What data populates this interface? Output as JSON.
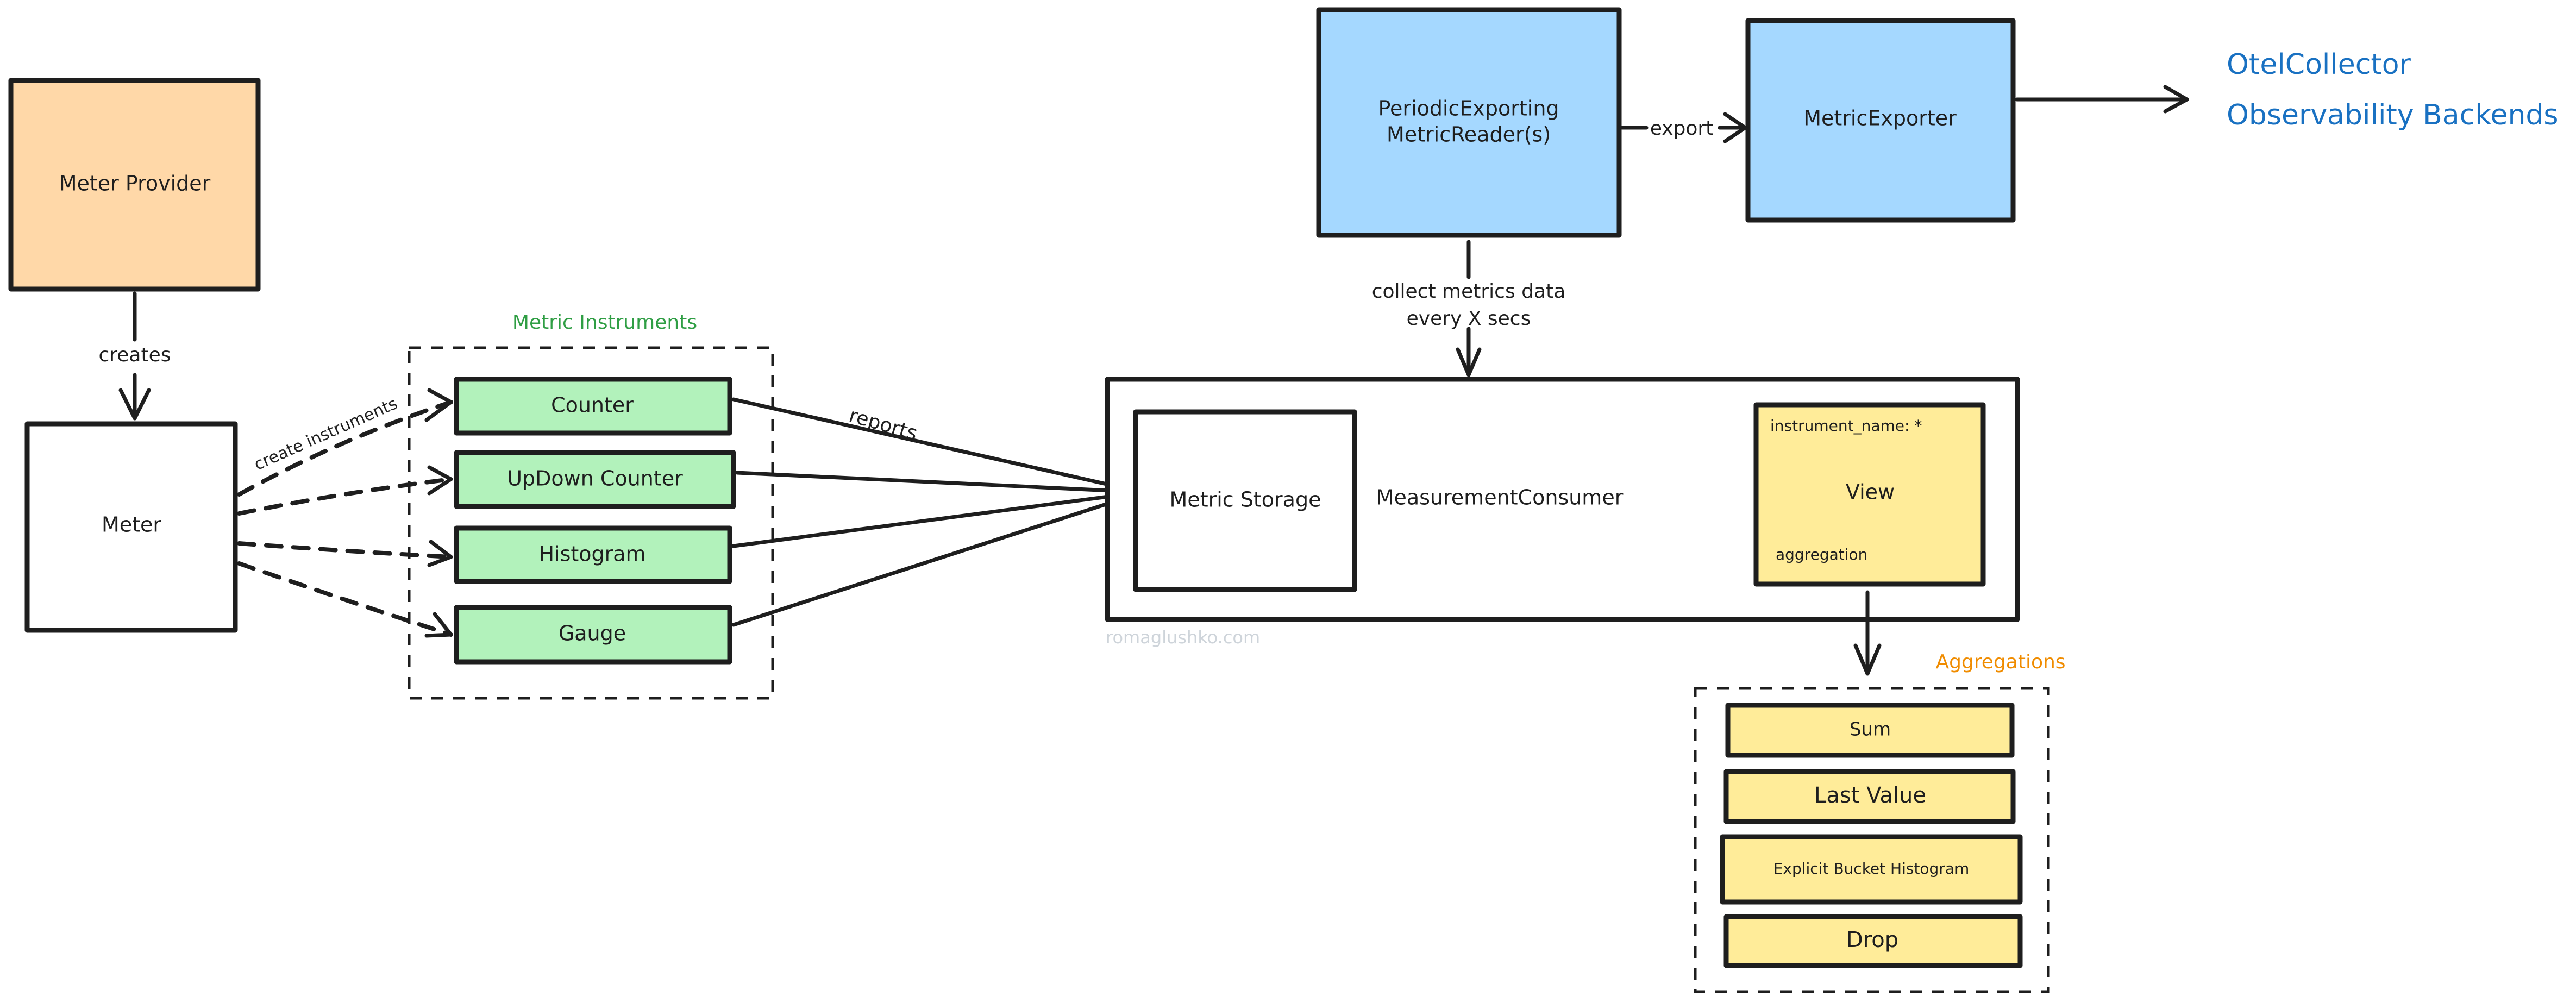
{
  "diagram": {
    "colors": {
      "stroke": "#1e1e1e",
      "meter_provider_fill": "#ffd8a8",
      "instrument_fill": "#b2f2bb",
      "reader_fill": "#a5d8ff",
      "view_fill": "#ffec99",
      "aggregation_fill": "#ffec99",
      "instruments_title": "#2f9e44",
      "aggregations_title": "#f08c00",
      "backends_text": "#1971c2",
      "watermark": "#ced4da"
    },
    "nodes": {
      "meter_provider": "Meter Provider",
      "meter": "Meter",
      "periodic_reader_line1": "PeriodicExporting",
      "periodic_reader_line2": "MetricReader(s)",
      "metric_exporter": "MetricExporter",
      "measurement_consumer": "MeasurementConsumer",
      "metric_storage": "Metric Storage",
      "view": {
        "title": "View",
        "instrument_name": "instrument_name: *",
        "aggregation": "aggregation"
      }
    },
    "groups": {
      "instruments": {
        "title": "Metric Instruments",
        "items": [
          "Counter",
          "UpDown Counter",
          "Histogram",
          "Gauge"
        ]
      },
      "aggregations": {
        "title": "Aggregations",
        "items": [
          "Sum",
          "Last Value",
          "Explicit Bucket Histogram",
          "Drop"
        ]
      }
    },
    "destinations": {
      "line1": "OtelCollector",
      "line2": "Observability Backends"
    },
    "edges": {
      "creates": "creates",
      "create_instruments": "create instruments",
      "reports": "reports",
      "collect_line1": "collect metrics data",
      "collect_line2": "every X secs",
      "export": "export"
    },
    "watermark": "romaglushko.com"
  }
}
